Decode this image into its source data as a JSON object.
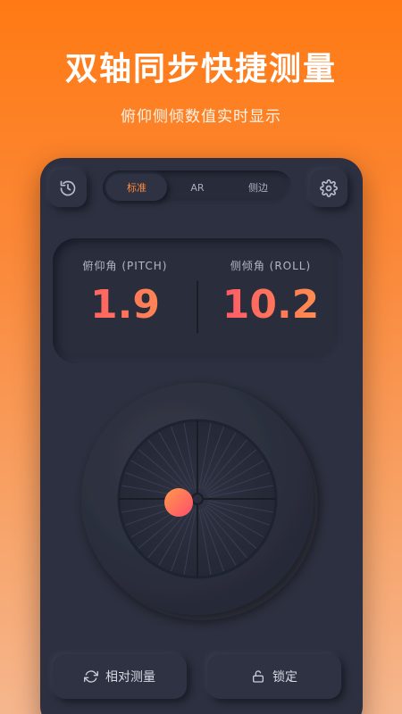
{
  "hero": {
    "title": "双轴同步快捷测量",
    "subtitle": "俯仰侧倾数值实时显示"
  },
  "toolbar": {
    "history_icon": "history-icon",
    "settings_icon": "gear-icon",
    "tabs": [
      {
        "label": "标准",
        "active": true
      },
      {
        "label": "AR",
        "active": false
      },
      {
        "label": "侧边",
        "active": false
      }
    ]
  },
  "readout": {
    "pitch": {
      "label": "俯仰角 (PITCH)",
      "value": "1.9"
    },
    "roll": {
      "label": "侧倾角 (ROLL)",
      "value": "10.2"
    }
  },
  "actions": {
    "relative": {
      "label": "相对测量",
      "icon": "refresh-icon"
    },
    "lock": {
      "label": "锁定",
      "icon": "unlock-icon"
    }
  },
  "colors": {
    "accent": "#ff8a3d",
    "value_gradient_start": "#ff4d6d",
    "value_gradient_end": "#ff9a4a",
    "panel": "#2d3040"
  }
}
